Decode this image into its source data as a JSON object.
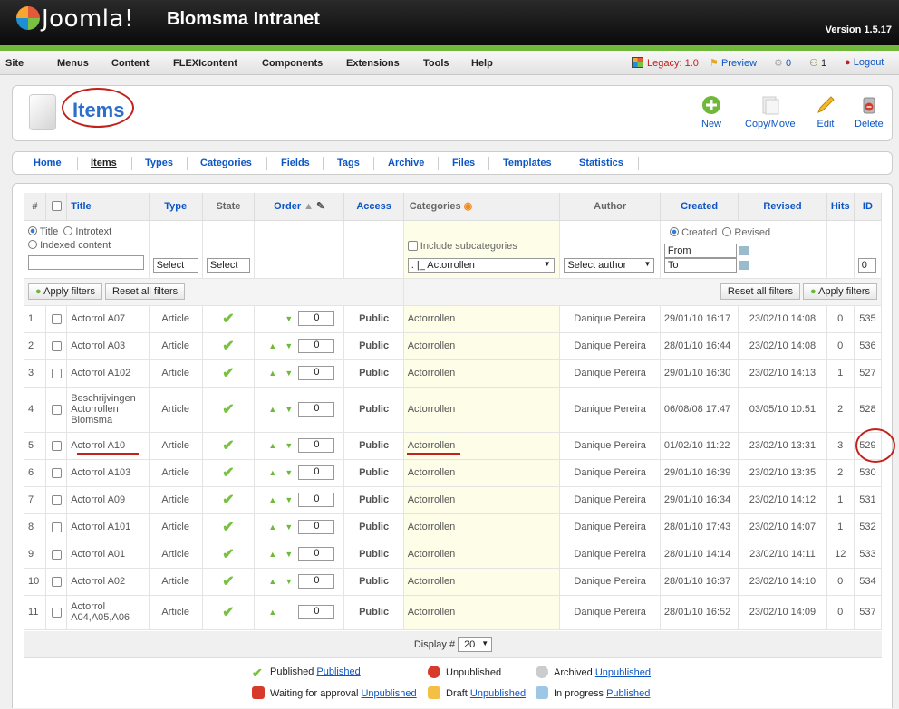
{
  "header": {
    "logo": "Joomla!",
    "site_name": "Blomsma Intranet",
    "version": "Version 1.5.17"
  },
  "menu": {
    "items": [
      "Site",
      "Menus",
      "Content",
      "FLEXIcontent",
      "Components",
      "Extensions",
      "Tools",
      "Help"
    ],
    "legacy": "Legacy: 1.0",
    "preview": "Preview",
    "messages": "0",
    "users": "1",
    "logout": "Logout"
  },
  "page": {
    "title": "Items"
  },
  "toolbar": {
    "new": "New",
    "copy_move": "Copy/Move",
    "edit": "Edit",
    "delete": "Delete"
  },
  "subnav": [
    "Home",
    "Items",
    "Types",
    "Categories",
    "Fields",
    "Tags",
    "Archive",
    "Files",
    "Templates",
    "Statistics"
  ],
  "columns": {
    "num": "#",
    "title": "Title",
    "type": "Type",
    "state": "State",
    "order": "Order",
    "access": "Access",
    "categories": "Categories",
    "author": "Author",
    "created": "Created",
    "revised": "Revised",
    "hits": "Hits",
    "id": "ID"
  },
  "filters": {
    "search_title": "Title",
    "search_introtext": "Introtext",
    "search_indexed": "Indexed content",
    "type_select": "Select",
    "state_select": "Select",
    "include_subcategories": "Include subcategories",
    "category_select": ". |_ Actorrollen",
    "author_select": "Select author",
    "date_created": "Created",
    "date_revised": "Revised",
    "from_placeholder": "From",
    "to_placeholder": "To",
    "id_value": "0",
    "apply": "Apply filters",
    "reset": "Reset all filters"
  },
  "rows": [
    {
      "num": "1",
      "title": "Actorrol A07",
      "type": "Article",
      "order": "0",
      "access": "Public",
      "category": "Actorrollen",
      "author": "Danique Pereira",
      "created": "29/01/10 16:17",
      "revised": "23/02/10 14:08",
      "hits": "0",
      "id": "535",
      "up": false,
      "down": true
    },
    {
      "num": "2",
      "title": "Actorrol A03",
      "type": "Article",
      "order": "0",
      "access": "Public",
      "category": "Actorrollen",
      "author": "Danique Pereira",
      "created": "28/01/10 16:44",
      "revised": "23/02/10 14:08",
      "hits": "0",
      "id": "536",
      "up": true,
      "down": true
    },
    {
      "num": "3",
      "title": "Actorrol A102",
      "type": "Article",
      "order": "0",
      "access": "Public",
      "category": "Actorrollen",
      "author": "Danique Pereira",
      "created": "29/01/10 16:30",
      "revised": "23/02/10 14:13",
      "hits": "1",
      "id": "527",
      "up": true,
      "down": true
    },
    {
      "num": "4",
      "title": "Beschrijvingen Actorrollen Blomsma",
      "type": "Article",
      "order": "0",
      "access": "Public",
      "category": "Actorrollen",
      "author": "Danique Pereira",
      "created": "06/08/08 17:47",
      "revised": "03/05/10 10:51",
      "hits": "2",
      "id": "528",
      "up": true,
      "down": true
    },
    {
      "num": "5",
      "title": "Actorrol A10",
      "type": "Article",
      "order": "0",
      "access": "Public",
      "category": "Actorrollen",
      "author": "Danique Pereira",
      "created": "01/02/10 11:22",
      "revised": "23/02/10 13:31",
      "hits": "3",
      "id": "529",
      "up": true,
      "down": true
    },
    {
      "num": "6",
      "title": "Actorrol A103",
      "type": "Article",
      "order": "0",
      "access": "Public",
      "category": "Actorrollen",
      "author": "Danique Pereira",
      "created": "29/01/10 16:39",
      "revised": "23/02/10 13:35",
      "hits": "2",
      "id": "530",
      "up": true,
      "down": true
    },
    {
      "num": "7",
      "title": "Actorrol A09",
      "type": "Article",
      "order": "0",
      "access": "Public",
      "category": "Actorrollen",
      "author": "Danique Pereira",
      "created": "29/01/10 16:34",
      "revised": "23/02/10 14:12",
      "hits": "1",
      "id": "531",
      "up": true,
      "down": true
    },
    {
      "num": "8",
      "title": "Actorrol A101",
      "type": "Article",
      "order": "0",
      "access": "Public",
      "category": "Actorrollen",
      "author": "Danique Pereira",
      "created": "28/01/10 17:43",
      "revised": "23/02/10 14:07",
      "hits": "1",
      "id": "532",
      "up": true,
      "down": true
    },
    {
      "num": "9",
      "title": "Actorrol A01",
      "type": "Article",
      "order": "0",
      "access": "Public",
      "category": "Actorrollen",
      "author": "Danique Pereira",
      "created": "28/01/10 14:14",
      "revised": "23/02/10 14:11",
      "hits": "12",
      "id": "533",
      "up": true,
      "down": true
    },
    {
      "num": "10",
      "title": "Actorrol A02",
      "type": "Article",
      "order": "0",
      "access": "Public",
      "category": "Actorrollen",
      "author": "Danique Pereira",
      "created": "28/01/10 16:37",
      "revised": "23/02/10 14:10",
      "hits": "0",
      "id": "534",
      "up": true,
      "down": true
    },
    {
      "num": "11",
      "title": "Actorrol A04,A05,A06",
      "type": "Article",
      "order": "0",
      "access": "Public",
      "category": "Actorrollen",
      "author": "Danique Pereira",
      "created": "28/01/10 16:52",
      "revised": "23/02/10 14:09",
      "hits": "0",
      "id": "537",
      "up": true,
      "down": false
    }
  ],
  "footer": {
    "display_label": "Display #",
    "display_value": "20"
  },
  "legend": [
    {
      "pre": "Published",
      "link": "Published",
      "icon": "published-icon"
    },
    {
      "pre": "Unpublished",
      "link": "",
      "icon": "unpublished-icon"
    },
    {
      "pre": "Archived",
      "link": "Unpublished",
      "icon": "archived-icon"
    },
    {
      "pre": "Waiting for approval",
      "link": "Unpublished",
      "icon": "waiting-icon"
    },
    {
      "pre": "Draft",
      "link": "Unpublished",
      "icon": "draft-icon"
    },
    {
      "pre": "In progress",
      "link": "Published",
      "icon": "in-progress-icon"
    }
  ]
}
